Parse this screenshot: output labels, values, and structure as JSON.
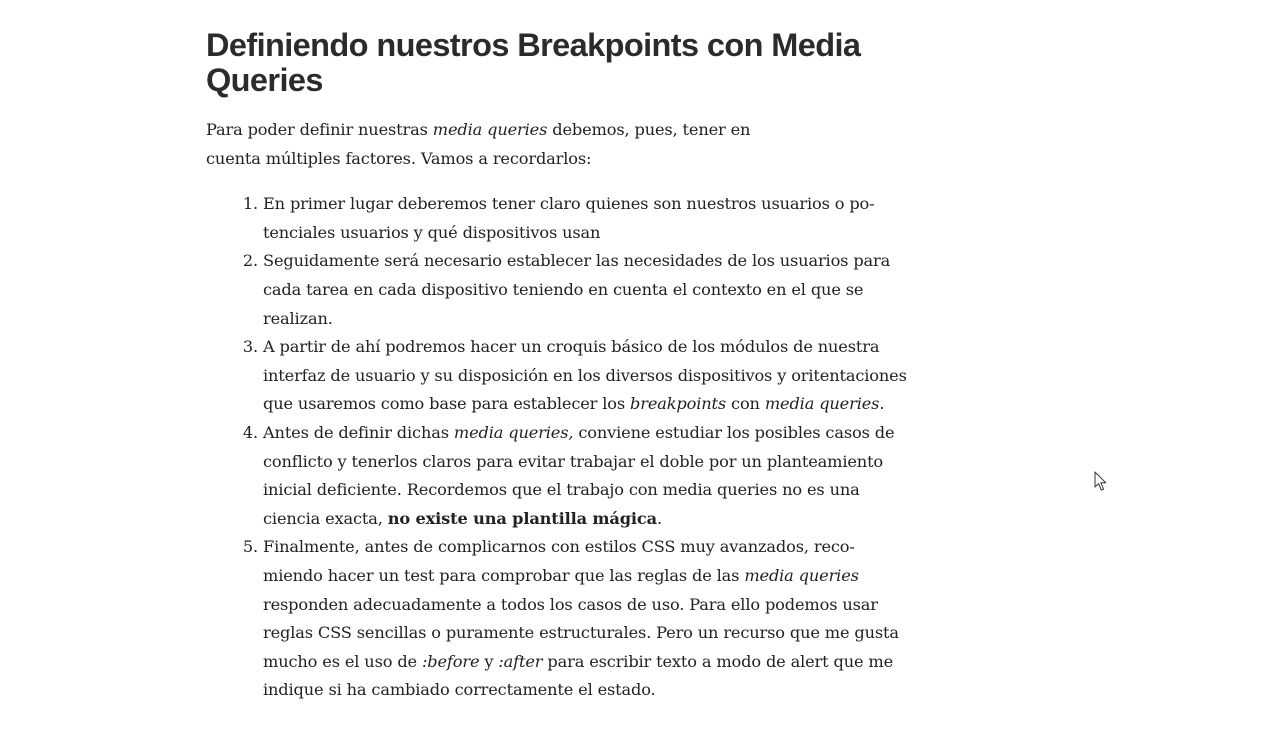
{
  "article": {
    "heading": "Definiendo nuestros Breakpoints con Media Queries",
    "intro": {
      "part1": "Para poder definir nuestras ",
      "em1": "media queries",
      "part2": " debemos, pues, tener en cuenta múltiples factores. Vamos a recordarlos:"
    },
    "list": [
      {
        "text": "En primer lugar deberemos tener claro quienes son nuestros usuarios o po­tenciales usuarios y qué dispositivos usan"
      },
      {
        "text": "Seguidamente será necesario establecer las necesidades de los usuarios para cada tarea en cada dispositivo teniendo en cuenta el contexto en el que se realizan."
      },
      {
        "a": "A partir de ahí podremos hacer un croquis básico de los módulos de nuestra interfaz de usuario y su disposición en los diversos dispositivos y oritentacio­nes que usaremos como base para establecer los ",
        "em1": "breakpoints",
        "b": " con ",
        "em2": "media queries",
        "c": "."
      },
      {
        "a": "Antes de definir dichas ",
        "em1": "media queries,",
        "b": " conviene estudiar los posibles casos de conflicto y tenerlos claros para evitar trabajar el doble por un plantea­miento inicial deficiente. Recordemos que el trabajo con media queries no es una ciencia exacta, ",
        "strong": "no existe una plantilla mágica",
        "c": "."
      },
      {
        "a": "Finalmente, antes de complicarnos con estilos CSS muy avanzados, reco­miendo hacer un test para comprobar que las reglas de las ",
        "em1": "media queries",
        "b": " responden adecuadamente a todos los casos de uso. Para ello podemos usar reglas CSS sencillas o puramente estructurales. Pero un recurso que me gusta mucho es el uso de ",
        "em2": ":before",
        "c": " y ",
        "em3": ":after",
        "d": " para escribir texto a modo de alert que me indique si ha cambiado correctamente el estado."
      }
    ]
  },
  "cursor": {
    "icon": "mouse-pointer-icon"
  }
}
